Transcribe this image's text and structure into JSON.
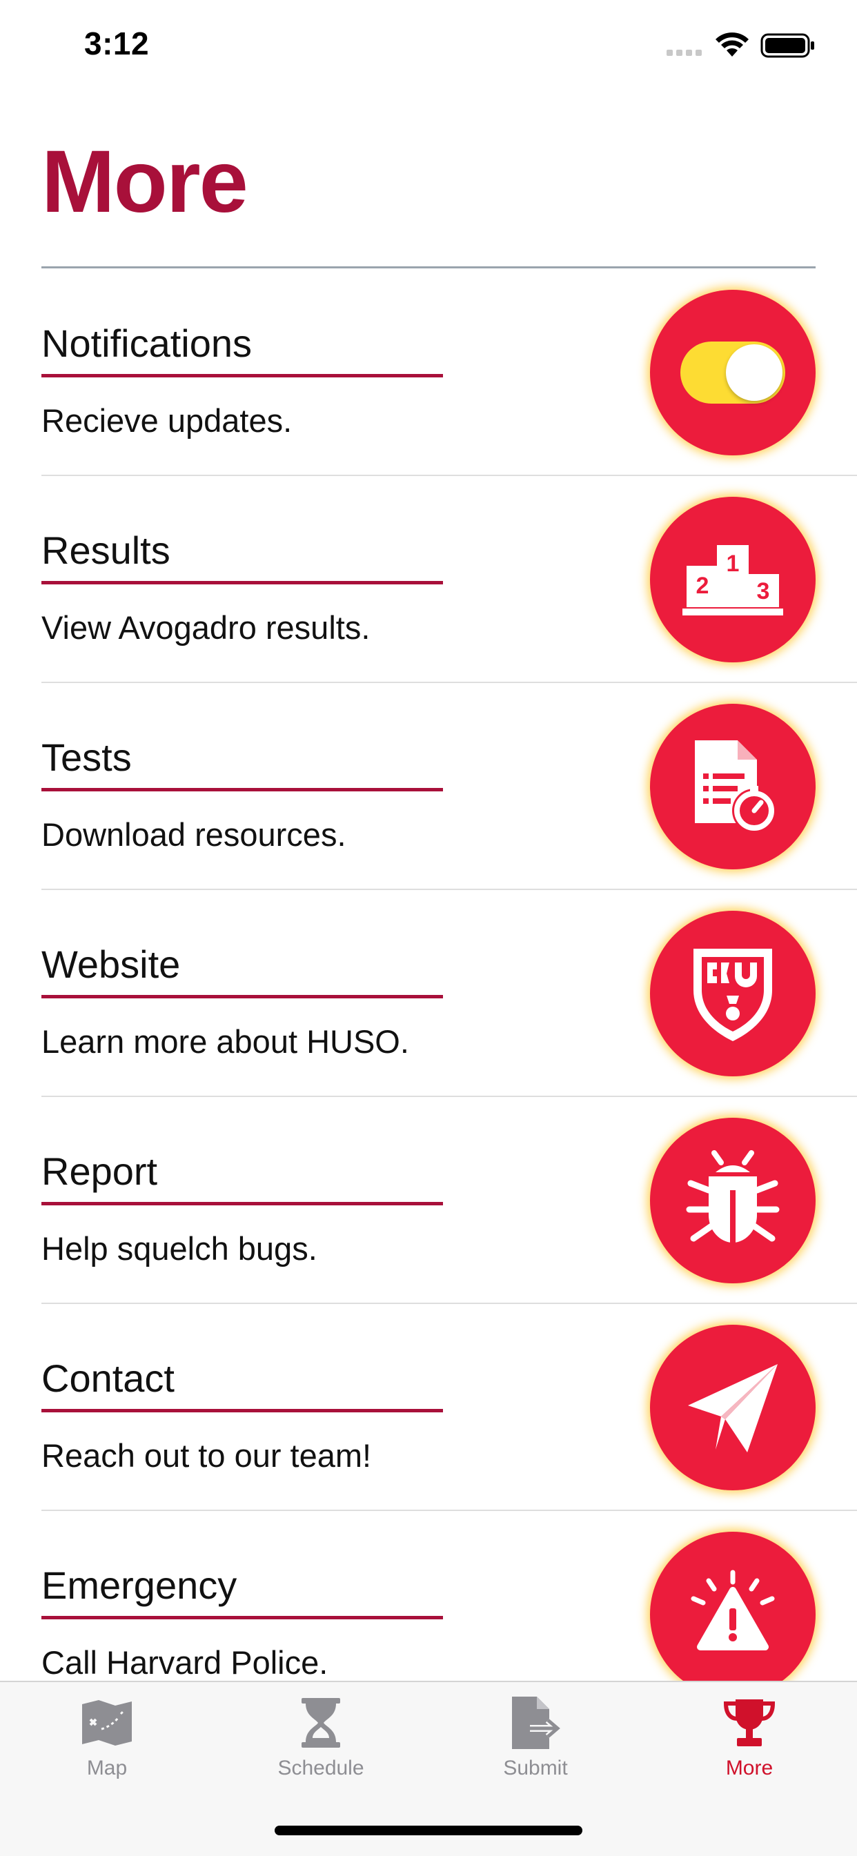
{
  "status_bar": {
    "time": "3:12",
    "icons": [
      "signal-icon",
      "wifi-icon",
      "battery-icon"
    ]
  },
  "page": {
    "title": "More"
  },
  "colors": {
    "accent": "#a8103a",
    "button_red": "#ec1c3c",
    "glow": "#ffc428",
    "toggle_on": "#fddc33",
    "tab_active": "#d0112b",
    "tab_inactive": "#8e8e93"
  },
  "rows": [
    {
      "title": "Notifications",
      "description": "Recieve updates.",
      "icon": "toggle-switch",
      "toggle_on": true
    },
    {
      "title": "Results",
      "description": "View Avogadro results.",
      "icon": "podium-icon"
    },
    {
      "title": "Tests",
      "description": "Download resources.",
      "icon": "document-timer-icon"
    },
    {
      "title": "Website",
      "description": "Learn more about HUSO.",
      "icon": "shield-logo-icon"
    },
    {
      "title": "Report",
      "description": "Help squelch bugs.",
      "icon": "bug-icon"
    },
    {
      "title": "Contact",
      "description": "Reach out to our team!",
      "icon": "paper-plane-icon"
    },
    {
      "title": "Emergency",
      "description": "Call Harvard Police.",
      "icon": "warning-icon"
    }
  ],
  "podium_numbers": [
    "1",
    "2",
    "3"
  ],
  "tab_bar": {
    "tabs": [
      {
        "label": "Map",
        "icon": "map-icon",
        "active": false
      },
      {
        "label": "Schedule",
        "icon": "hourglass-icon",
        "active": false
      },
      {
        "label": "Submit",
        "icon": "submit-document-icon",
        "active": false
      },
      {
        "label": "More",
        "icon": "trophy-icon",
        "active": true
      }
    ]
  }
}
